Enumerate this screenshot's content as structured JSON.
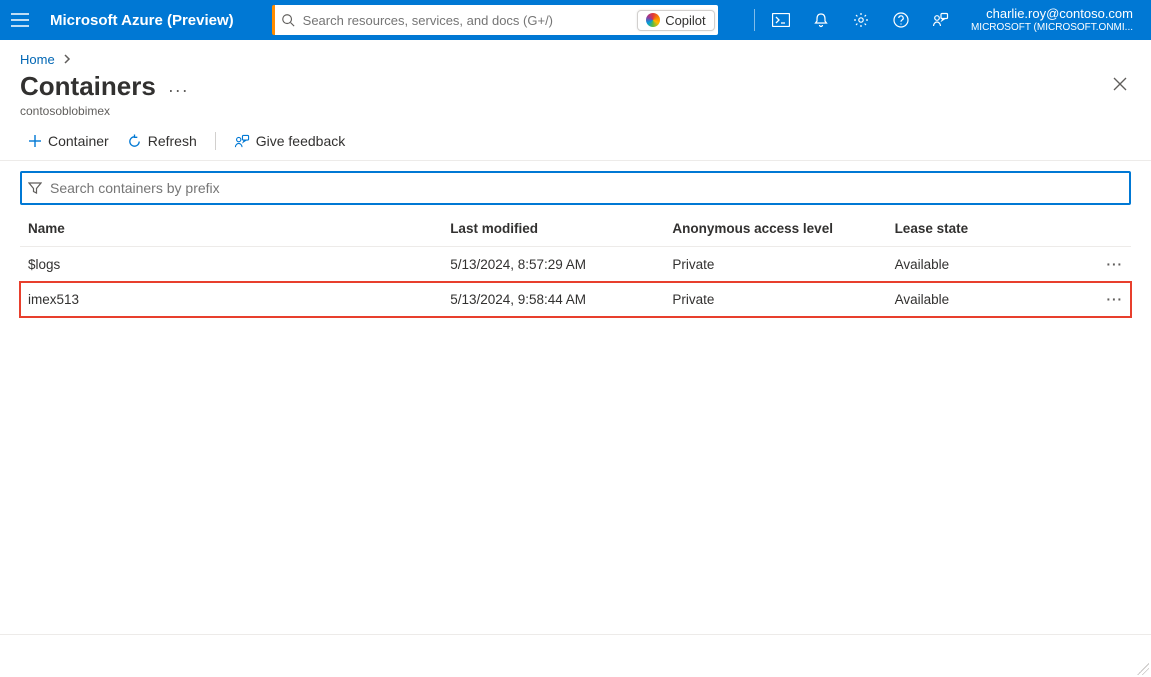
{
  "header": {
    "brand": "Microsoft Azure (Preview)",
    "search_placeholder": "Search resources, services, and docs (G+/)",
    "copilot_label": "Copilot",
    "account_email": "charlie.roy@contoso.com",
    "account_tenant": "MICROSOFT (MICROSOFT.ONMI..."
  },
  "breadcrumb": {
    "items": [
      "Home"
    ]
  },
  "page": {
    "title": "Containers",
    "subtitle": "contosoblobimex"
  },
  "toolbar": {
    "container_label": "Container",
    "refresh_label": "Refresh",
    "feedback_label": "Give feedback"
  },
  "filter": {
    "placeholder": "Search containers by prefix"
  },
  "table": {
    "columns": {
      "name": "Name",
      "modified": "Last modified",
      "access": "Anonymous access level",
      "lease": "Lease state"
    },
    "rows": [
      {
        "name": "$logs",
        "modified": "5/13/2024, 8:57:29 AM",
        "access": "Private",
        "lease": "Available",
        "highlight": false
      },
      {
        "name": "imex513",
        "modified": "5/13/2024, 9:58:44 AM",
        "access": "Private",
        "lease": "Available",
        "highlight": true
      }
    ]
  }
}
